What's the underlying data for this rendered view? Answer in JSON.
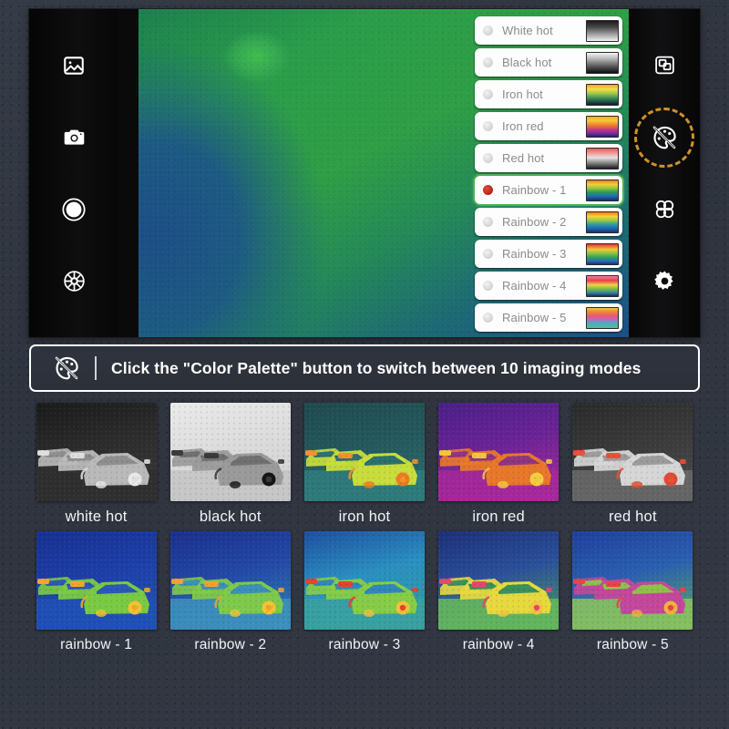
{
  "device": {
    "left_rail": [
      {
        "name": "gallery-icon",
        "label": "Gallery"
      },
      {
        "name": "camera-icon",
        "label": "Photo"
      },
      {
        "name": "shutter-icon",
        "label": "Shutter"
      },
      {
        "name": "aperture-icon",
        "label": "Aperture"
      }
    ],
    "right_rail": [
      {
        "name": "picture-in-picture-icon",
        "label": "Picture in Picture"
      },
      {
        "name": "color-palette-icon",
        "label": "Color Palette",
        "highlighted": true,
        "highlight_color": "#d99a2b"
      },
      {
        "name": "grid-apps-icon",
        "label": "Modes"
      },
      {
        "name": "gear-icon",
        "label": "Settings"
      }
    ]
  },
  "palette_menu": {
    "selected": "Rainbow - 1",
    "selected_color": "#4fb04f",
    "selected_radio_color": "#c8281a",
    "items": [
      {
        "label": "White hot",
        "selected": false,
        "swatch": "linear-gradient(180deg,#1a1a1a 0%,#4a4a4a 32%,#9a9a9a 64%,#f2f2f2 100%)"
      },
      {
        "label": "Black hot",
        "selected": false,
        "swatch": "linear-gradient(180deg,#f5f5f5 0%,#b5b5b5 30%,#5a5a5a 66%,#0e0e0e 100%)"
      },
      {
        "label": "Iron hot",
        "selected": false,
        "swatch": "linear-gradient(180deg,#f0a519 0%,#efe14a 22%,#9ec74a 44%,#3f8f57 66%,#1d4b46 86%,#101d22 100%)"
      },
      {
        "label": "Iron red",
        "selected": false,
        "swatch": "linear-gradient(180deg,#f4b018 0%,#f3c83f 20%,#ef7a2a 44%,#b8338f 68%,#6a2aa0 86%,#2a1d5e 100%)"
      },
      {
        "label": "Red hot",
        "selected": false,
        "swatch": "linear-gradient(180deg,#e85a58 0%,#f0a3a0 26%,#e3e3e3 46%,#8c8c8c 70%,#1c1c1c 100%)"
      },
      {
        "label": "Rainbow - 1",
        "selected": true,
        "swatch": "linear-gradient(180deg,#e8821c 0%,#f2d13a 20%,#8dc63f 40%,#2e9b52 58%,#1f6fb0 78%,#16306e 100%)"
      },
      {
        "label": "Rainbow - 2",
        "selected": false,
        "swatch": "linear-gradient(180deg,#ef7a1e 0%,#f3d63d 20%,#9ccb3c 40%,#2f9ea0 60%,#2266b4 80%,#1b2f72 100%)"
      },
      {
        "label": "Rainbow - 3",
        "selected": false,
        "swatch": "linear-gradient(180deg,#e23b2c 0%,#f0c93c 26%,#7cc242 48%,#2f9e62 66%,#2a6fb5 84%,#1c2f74 100%)"
      },
      {
        "label": "Rainbow - 4",
        "selected": false,
        "swatch": "linear-gradient(180deg,#ef7fa6 0%,#e8404a 22%,#edd246 44%,#79be41 64%,#2f7fa8 84%,#16314f 100%)"
      },
      {
        "label": "Rainbow - 5",
        "selected": false,
        "swatch": "linear-gradient(180deg,#f0c638 0%,#ee8a3a 18%,#ea5a6e 38%,#cf5fb2 54%,#4fa8c6 74%,#4fc08f 100%)"
      }
    ]
  },
  "banner": {
    "icon": "color-palette-slash-icon",
    "text": "Click the \"Color Palette\" button to switch between 10 imaging modes"
  },
  "thumbnails": {
    "rows": [
      [
        {
          "caption": "white hot",
          "bg": "linear-gradient(165deg,#1a1a1a 0%,#2c2c2c 45%,#3a3a3a 100%)",
          "body": "#b9b9b9",
          "glass": "#8d8d8d",
          "hot": "#dedede",
          "wheel": "#e8e8e8",
          "ground": "#2e2e2e"
        },
        {
          "caption": "black hot",
          "bg": "linear-gradient(165deg,#eaeaea 0%,#dcdcdc 45%,#cfcfcf 100%)",
          "body": "#9a9a9a",
          "glass": "#6f6f6f",
          "hot": "#3a3a3a",
          "wheel": "#141414",
          "ground": "#c4c4c4"
        },
        {
          "caption": "iron hot",
          "bg": "linear-gradient(165deg,#1f4a4e 0%,#24585c 45%,#2c6f72 100%)",
          "body": "#c8dd3c",
          "glass": "#2b6f6c",
          "hot": "#f0932a",
          "wheel": "#ef7a1e",
          "ground": "#2f7d7e"
        },
        {
          "caption": "iron red",
          "bg": "linear-gradient(165deg,#4a1f87 0%,#6a2396 45%,#b32a9a 100%)",
          "body": "#e8772a",
          "glass": "#8d3580",
          "hot": "#f3c63c",
          "wheel": "#f2cf3e",
          "ground": "#a6289a"
        },
        {
          "caption": "red hot",
          "bg": "linear-gradient(165deg,#2a2a2a 0%,#3a3a3a 45%,#4d4d4d 100%)",
          "body": "#d6d6d6",
          "glass": "#9b9b9b",
          "hot": "#e8503a",
          "wheel": "#e04a32",
          "ground": "#6a6a6a"
        }
      ],
      [
        {
          "caption": "rainbow - 1",
          "bg": "linear-gradient(165deg,#17308f 0%,#1d3ea8 45%,#2255bb 100%)",
          "body": "#7ac943",
          "glass": "#2a56b8",
          "hot": "#f0a62a",
          "wheel": "#f2c32f",
          "ground": "#2050b5"
        },
        {
          "caption": "rainbow - 2",
          "bg": "linear-gradient(165deg,#1b2f8c 0%,#2348a6 45%,#2f86b5 100%)",
          "body": "#7ec94a",
          "glass": "#3a8fb8",
          "hot": "#efa22c",
          "wheel": "#f1c434",
          "ground": "#3d93bd"
        },
        {
          "caption": "rainbow - 3",
          "bg": "linear-gradient(165deg,#1c4fa0 0%,#2a8fc0 45%,#2f9e9a 100%)",
          "body": "#86cc46",
          "glass": "#2f86b8",
          "hot": "#e8402f",
          "wheel": "#f0c13c",
          "ground": "#3aa1a0"
        },
        {
          "caption": "rainbow - 4",
          "bg": "linear-gradient(165deg,#1c2f78 0%,#2b4f9a 45%,#4fa05a 100%)",
          "body": "#e6d93e",
          "glass": "#3a8f5a",
          "hot": "#e8456e",
          "wheel": "#f2c63c",
          "ground": "#66bb5c"
        },
        {
          "caption": "rainbow - 5",
          "bg": "linear-gradient(165deg,#1f3f9c 0%,#2a5fb0 45%,#5fb05a 100%)",
          "body": "#c4479c",
          "glass": "#8fbf4a",
          "hot": "#e8424a",
          "wheel": "#f0b23c",
          "ground": "#8cc45e"
        }
      ]
    ]
  }
}
